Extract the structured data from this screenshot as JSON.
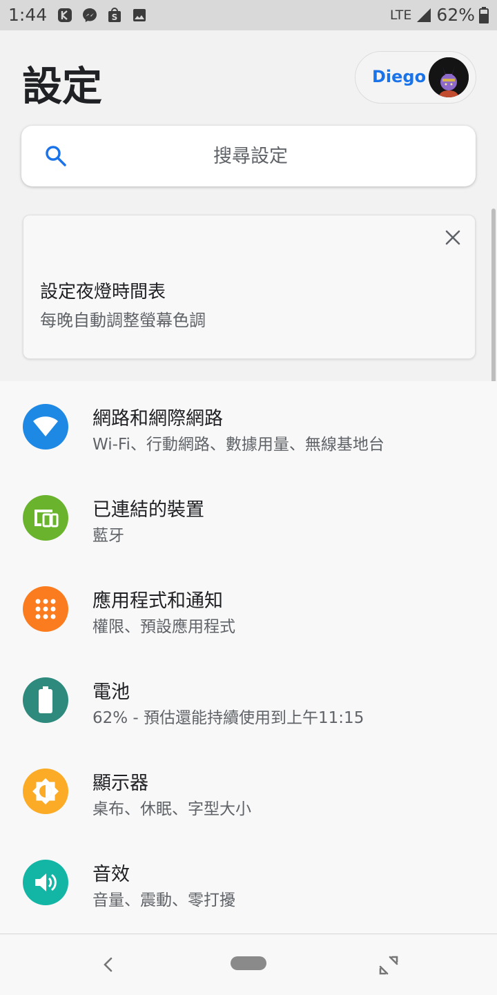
{
  "status_bar": {
    "time": "1:44",
    "network": "LTE",
    "battery": "62%",
    "notification_icons": [
      "k-app-icon",
      "messenger-icon",
      "shop-bag-icon",
      "image-icon"
    ]
  },
  "header": {
    "title": "設定",
    "account_name": "Diego"
  },
  "search": {
    "placeholder": "搜尋設定"
  },
  "suggestion_card": {
    "icon": "moon-icon",
    "title": "設定夜燈時間表",
    "subtitle": "每晚自動調整螢幕色調"
  },
  "settings": [
    {
      "icon": "wifi-icon",
      "color": "#1e88e5",
      "title": "網路和網際網路",
      "subtitle": "Wi-Fi、行動網路、數據用量、無線基地台"
    },
    {
      "icon": "devices-icon",
      "color": "#6ab42d",
      "title": "已連結的裝置",
      "subtitle": "藍牙"
    },
    {
      "icon": "apps-icon",
      "color": "#fb7c1e",
      "title": "應用程式和通知",
      "subtitle": "權限、預設應用程式"
    },
    {
      "icon": "battery-icon",
      "color": "#2d8a7d",
      "title": "電池",
      "subtitle": "62% - 預估還能持續使用到上午11:15"
    },
    {
      "icon": "brightness-icon",
      "color": "#fbab25",
      "title": "顯示器",
      "subtitle": "桌布、休眠、字型大小"
    },
    {
      "icon": "volume-icon",
      "color": "#13b5a5",
      "title": "音效",
      "subtitle": "音量、震動、零打擾"
    }
  ],
  "colors": {
    "accent": "#1a73e8",
    "background": "#f2f2f2",
    "list_background": "#f8f8f8"
  }
}
